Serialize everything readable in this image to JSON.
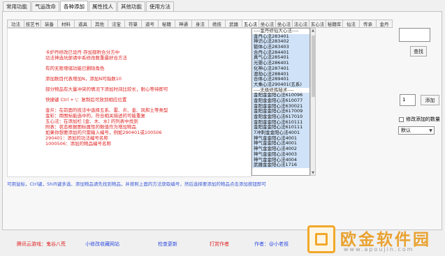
{
  "top_tabs": [
    "常用功能",
    "气运改命",
    "各种添加",
    "属性找人",
    "其他功能",
    "使用方法"
  ],
  "sub_tabs": [
    "功法",
    "技艺书",
    "装备",
    "材料",
    "道具",
    "其他",
    "法宝",
    "符箓",
    "道号",
    "秘籍",
    "神通",
    "身法",
    "绝技",
    "武器",
    "五心法",
    "坐心法",
    "坐心法",
    "法心法",
    "玄心法",
    "秘籍库",
    "仙法",
    "传承",
    "金丹"
  ],
  "red_lines": [
    "卡炉丹修改已设丹 存加部附合分方中",
    "功法神选坑部请中系修改数重最好合方法",
    "",
    "有的无限增储功能已删除角色",
    "",
    "添加数目代表增加N，添加N可指数10",
    "",
    "部分物品有大量冲突的情况下添加时间比较长，耐心等待即可",
    "",
    "快捷键 Ctrl + \\：复制后可放到相应位置",
    "",
    "金炎：在前面的技法中选择五系、雷、炎、金、风和土等类型",
    "金彩：用图标能选中的，符合相关描述的可能重复",
    "五心法：在添加栏 [金、木、水] 的列表中找到",
    "附表：状态根据图标属性的数值作为增加物品",
    "如果你想要添加的只需输入编号，例如290401或100506",
    "290401：添加的功法编号名称",
    "1000506：添加的物品编号名称"
  ],
  "list_items": [
    "----金丹修仙大心法----",
    "金丹心法283401",
    "神识心法283402",
    "锻体心法283403",
    "合丹心法284401",
    "真气心法285401",
    "元婴心法286401",
    "化神心法287401",
    "渡劫心法288401",
    "合体心法289401",
    "大乘心法290401(五系)",
    "----无极修炼秘术----",
    "金阳金金阳心法610096",
    "金阳金金阳心法610077",
    "金阳金金阳心法630021",
    "金阳金金阳心法617009",
    "金阳金金阳心法617010",
    "金阳金金阳心法610111",
    "金阳金金阳心法610111",
    "7冲刺金金阳心法4001",
    "神气金金阳心法4001",
    "神气金金阳心法4001",
    "神气金金阳心法4002",
    "神气金金阳心法4003",
    "神气金金阳心法4004",
    "武器金金阳心法1716"
  ],
  "right_panel": {
    "name_input_value": "",
    "name_button": "查找",
    "count_input_value": "1",
    "add_button": "添加",
    "checkbox_label": "修改添加的数量",
    "select_value": "默认"
  },
  "hint": "可用鼠标，Ctrl键，Shift键多选、添加物品请先找到物品，并按照上面的方法获取编号，然后选择要添加的物品点击添加按钮即可",
  "footer": {
    "item1": "腾讯云游戏：鬼谷八荒",
    "item2": "小修改收藏网站",
    "item3": "检查更新",
    "item4": "打赏作者",
    "item5": "作者：@小老祖"
  },
  "watermark": {
    "text": "欧金软件园",
    "url": "www.apoujin.com"
  },
  "colors": {
    "red_text": "#e02222",
    "blue_text": "#2d4ae0",
    "logo_orange": "#f2a82a"
  }
}
